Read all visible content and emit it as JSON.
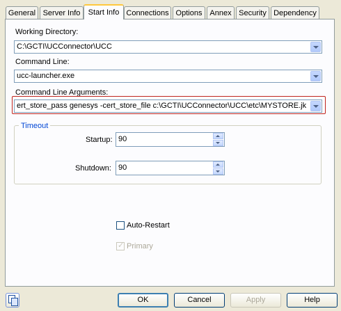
{
  "tabs": [
    {
      "label": "General"
    },
    {
      "label": "Server Info"
    },
    {
      "label": "Start Info"
    },
    {
      "label": "Connections"
    },
    {
      "label": "Options"
    },
    {
      "label": "Annex"
    },
    {
      "label": "Security"
    },
    {
      "label": "Dependency"
    }
  ],
  "active_tab": "Start Info",
  "form": {
    "working_directory": {
      "label": "Working Directory:",
      "value": "C:\\GCTI\\UCConnector\\UCC"
    },
    "command_line": {
      "label": "Command Line:",
      "value": "ucc-launcher.exe"
    },
    "command_line_arguments": {
      "label": "Command Line Arguments:",
      "value": "ert_store_pass genesys  -cert_store_file c:\\GCTI\\UCConnector\\UCC\\etc\\MYSTORE.jks"
    }
  },
  "timeout": {
    "title": "Timeout",
    "startup": {
      "label": "Startup:",
      "value": "90"
    },
    "shutdown": {
      "label": "Shutdown:",
      "value": "90"
    }
  },
  "auto_restart": {
    "label": "Auto-Restart",
    "checked": false
  },
  "primary": {
    "label": "Primary",
    "checked": true,
    "disabled": true
  },
  "buttons": {
    "ok": "OK",
    "cancel": "Cancel",
    "apply": "Apply",
    "help": "Help"
  },
  "colors": {
    "highlight_border": "#c0241d",
    "group_title": "#0046d5"
  }
}
